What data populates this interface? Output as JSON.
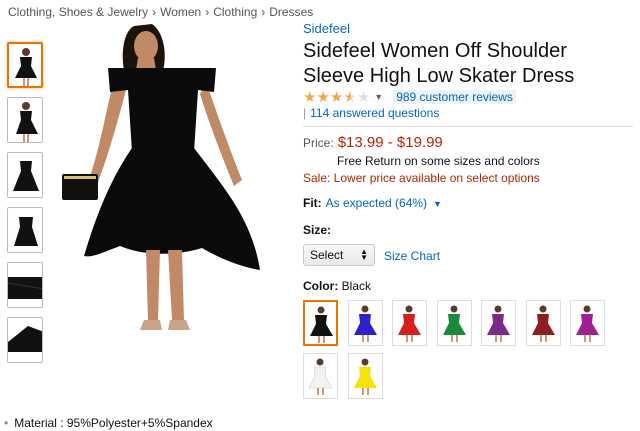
{
  "breadcrumb": [
    "Clothing, Shoes & Jewelry",
    "Women",
    "Clothing",
    "Dresses"
  ],
  "breadcrumb_separator": "›",
  "product": {
    "brand": "Sidefeel",
    "title": "Sidefeel Women Off Shoulder Sleeve High Low Skater Dress",
    "rating_stars": 3.5,
    "reviews_link": "989 customer reviews",
    "answered_questions": "114 answered questions",
    "price_label": "Price:",
    "price_value": "$13.99 - $19.99",
    "free_return": "Free Return on some sizes and colors",
    "sale_text": "Sale:  Lower price available on select options",
    "fit_label": "Fit:",
    "fit_value": "As expected (64%)",
    "size_label": "Size:",
    "size_select": "Select",
    "size_chart": "Size Chart",
    "color_label": "Color:",
    "color_value": "Black",
    "material": "Material : 95%Polyester+5%Spandex"
  },
  "swatch_colors": [
    "#111111",
    "#2b22c9",
    "#d61f1f",
    "#1b8a3c",
    "#7b2b87",
    "#8e1c22",
    "#a01f92",
    "#f2f2f2",
    "#f4e20b"
  ],
  "thumbnail_count": 6,
  "colors": {
    "link": "#0066c0",
    "price": "#b12704",
    "star": "#f3a847",
    "selected_border": "#e77600"
  }
}
